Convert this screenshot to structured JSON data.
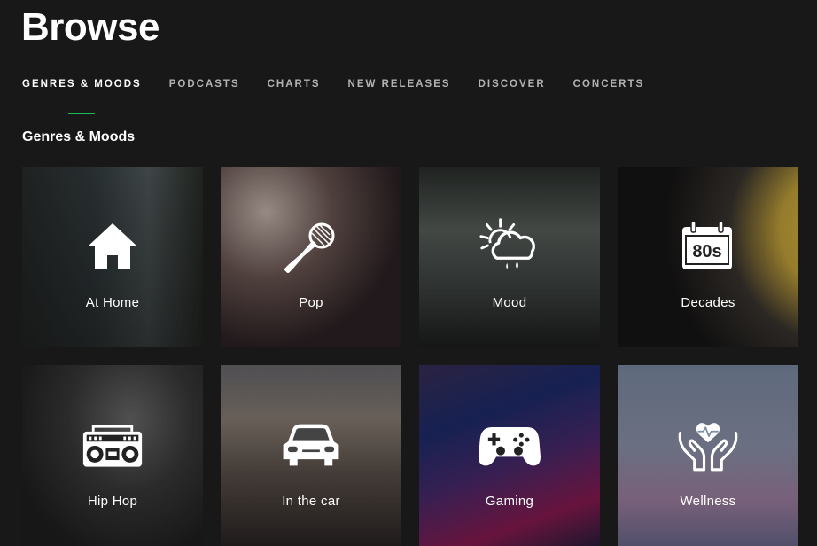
{
  "header": {
    "title": "Browse"
  },
  "tabs": [
    {
      "label": "GENRES & MOODS",
      "active": true
    },
    {
      "label": "PODCASTS",
      "active": false
    },
    {
      "label": "CHARTS",
      "active": false
    },
    {
      "label": "NEW RELEASES",
      "active": false
    },
    {
      "label": "DISCOVER",
      "active": false
    },
    {
      "label": "CONCERTS",
      "active": false
    }
  ],
  "section": {
    "title": "Genres & Moods"
  },
  "tiles": [
    {
      "label": "At Home",
      "icon": "house-icon"
    },
    {
      "label": "Pop",
      "icon": "microphone-icon"
    },
    {
      "label": "Mood",
      "icon": "weather-icon"
    },
    {
      "label": "Decades",
      "icon": "calendar-80s-icon"
    },
    {
      "label": "Hip Hop",
      "icon": "boombox-icon"
    },
    {
      "label": "In the car",
      "icon": "car-icon"
    },
    {
      "label": "Gaming",
      "icon": "gamepad-icon"
    },
    {
      "label": "Wellness",
      "icon": "heart-hands-icon"
    }
  ],
  "decades_icon_text": "80s",
  "colors": {
    "accent": "#1db954",
    "background": "#181818"
  }
}
